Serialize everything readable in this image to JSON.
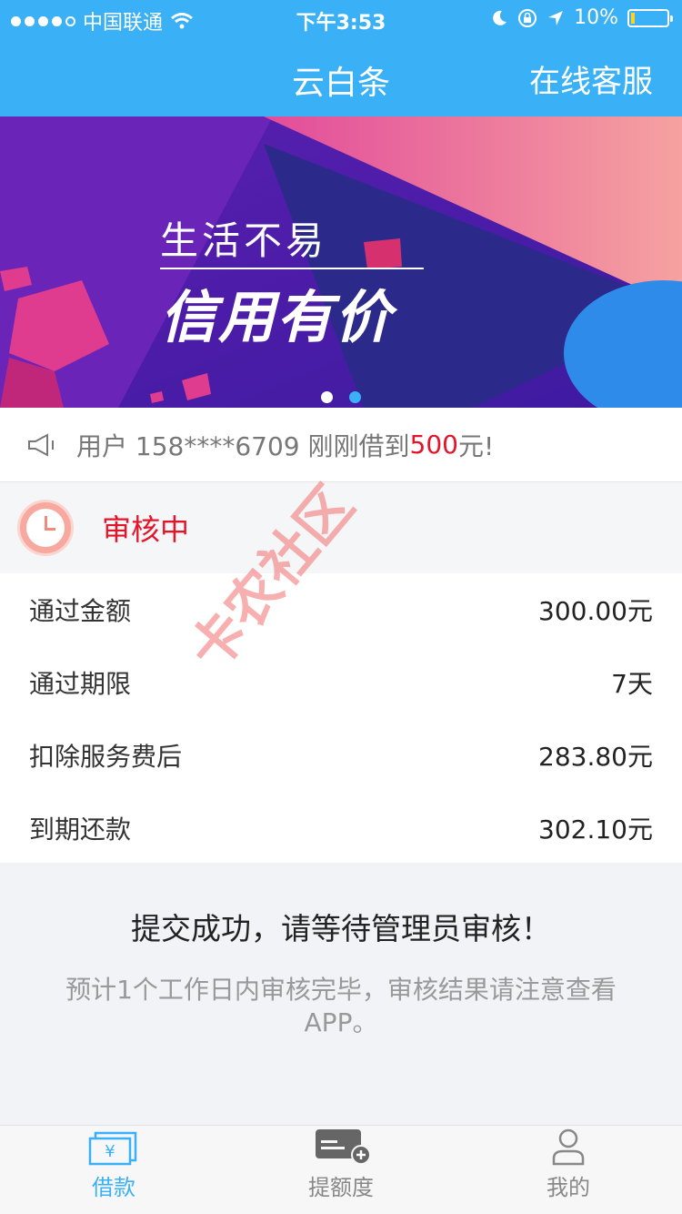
{
  "status_bar": {
    "carrier": "中国联通",
    "time": "下午3:53",
    "battery": "10%",
    "battery_level": 0.1
  },
  "header": {
    "title": "云白条",
    "service_label": "在线客服"
  },
  "banner": {
    "line1": "生活不易",
    "line2": "信用有价",
    "slides": 2,
    "active_slide": 2
  },
  "notice": {
    "prefix": "用户 158****6709 刚刚借到",
    "amount": "500",
    "suffix": "元!"
  },
  "review": {
    "status": "审核中"
  },
  "details": [
    {
      "label": "通过金额",
      "value": "300.00元"
    },
    {
      "label": "通过期限",
      "value": "7天"
    },
    {
      "label": "扣除服务费后",
      "value": "283.80元"
    },
    {
      "label": "到期还款",
      "value": "302.10元"
    }
  ],
  "message": {
    "title": "提交成功，请等待管理员审核！",
    "subtitle": "预计1个工作日内审核完毕，审核结果请注意查看APP。"
  },
  "watermark": "卡农社区",
  "tabs": [
    {
      "label": "借款",
      "active": true
    },
    {
      "label": "提额度",
      "active": false
    },
    {
      "label": "我的",
      "active": false
    }
  ],
  "colors": {
    "accent": "#3ab0f6",
    "highlight": "#e4152a"
  }
}
